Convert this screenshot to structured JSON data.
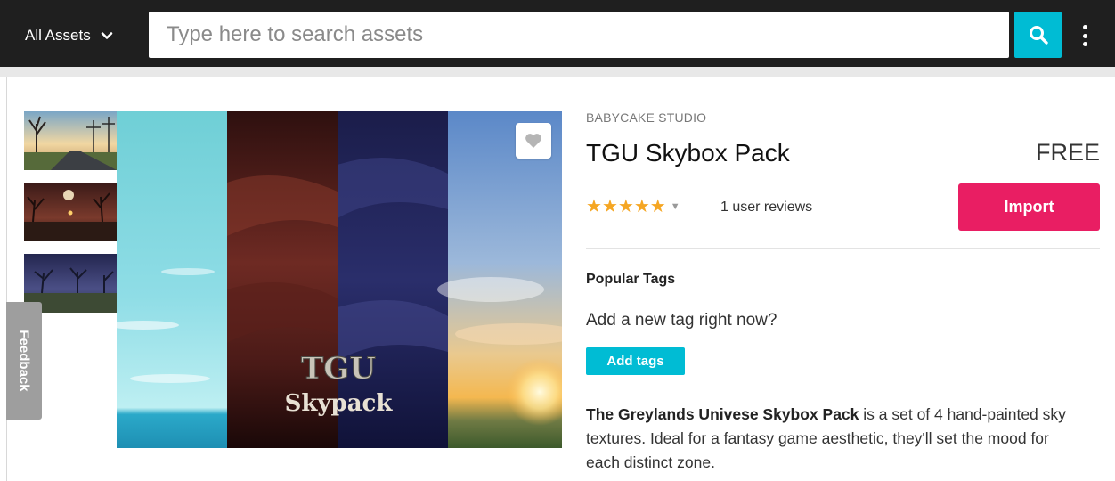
{
  "header": {
    "category_label": "All Assets",
    "search_placeholder": "Type here to search assets"
  },
  "feedback_label": "Feedback",
  "product": {
    "publisher": "BABYCAKE STUDIO",
    "title": "TGU Skybox Pack",
    "price": "FREE",
    "rating": 5,
    "rating_max": 5,
    "reviews_label": "1 user reviews",
    "import_label": "Import",
    "image_logo_text": "TGU",
    "image_subtitle": "Skypack",
    "thumbnails": [
      "thumbnail-1",
      "thumbnail-2",
      "thumbnail-3"
    ]
  },
  "tags": {
    "heading": "Popular Tags",
    "prompt": "Add a new tag right now?",
    "add_label": "Add tags"
  },
  "description": {
    "bold": "The Greylands Univese Skybox Pack",
    "rest": " is a set of 4 hand-painted sky textures. Ideal for a fantasy game aesthetic, they'll set the mood for each distinct zone."
  },
  "colors": {
    "topbar": "#1f1f1f",
    "accent_cyan": "#00bcd4",
    "import_pink": "#e91e63",
    "star": "#f5a623"
  },
  "icons": {
    "search": "search-icon",
    "menu": "kebab-menu-icon",
    "heart": "heart-icon",
    "dropdown": "chevron-down-icon"
  }
}
